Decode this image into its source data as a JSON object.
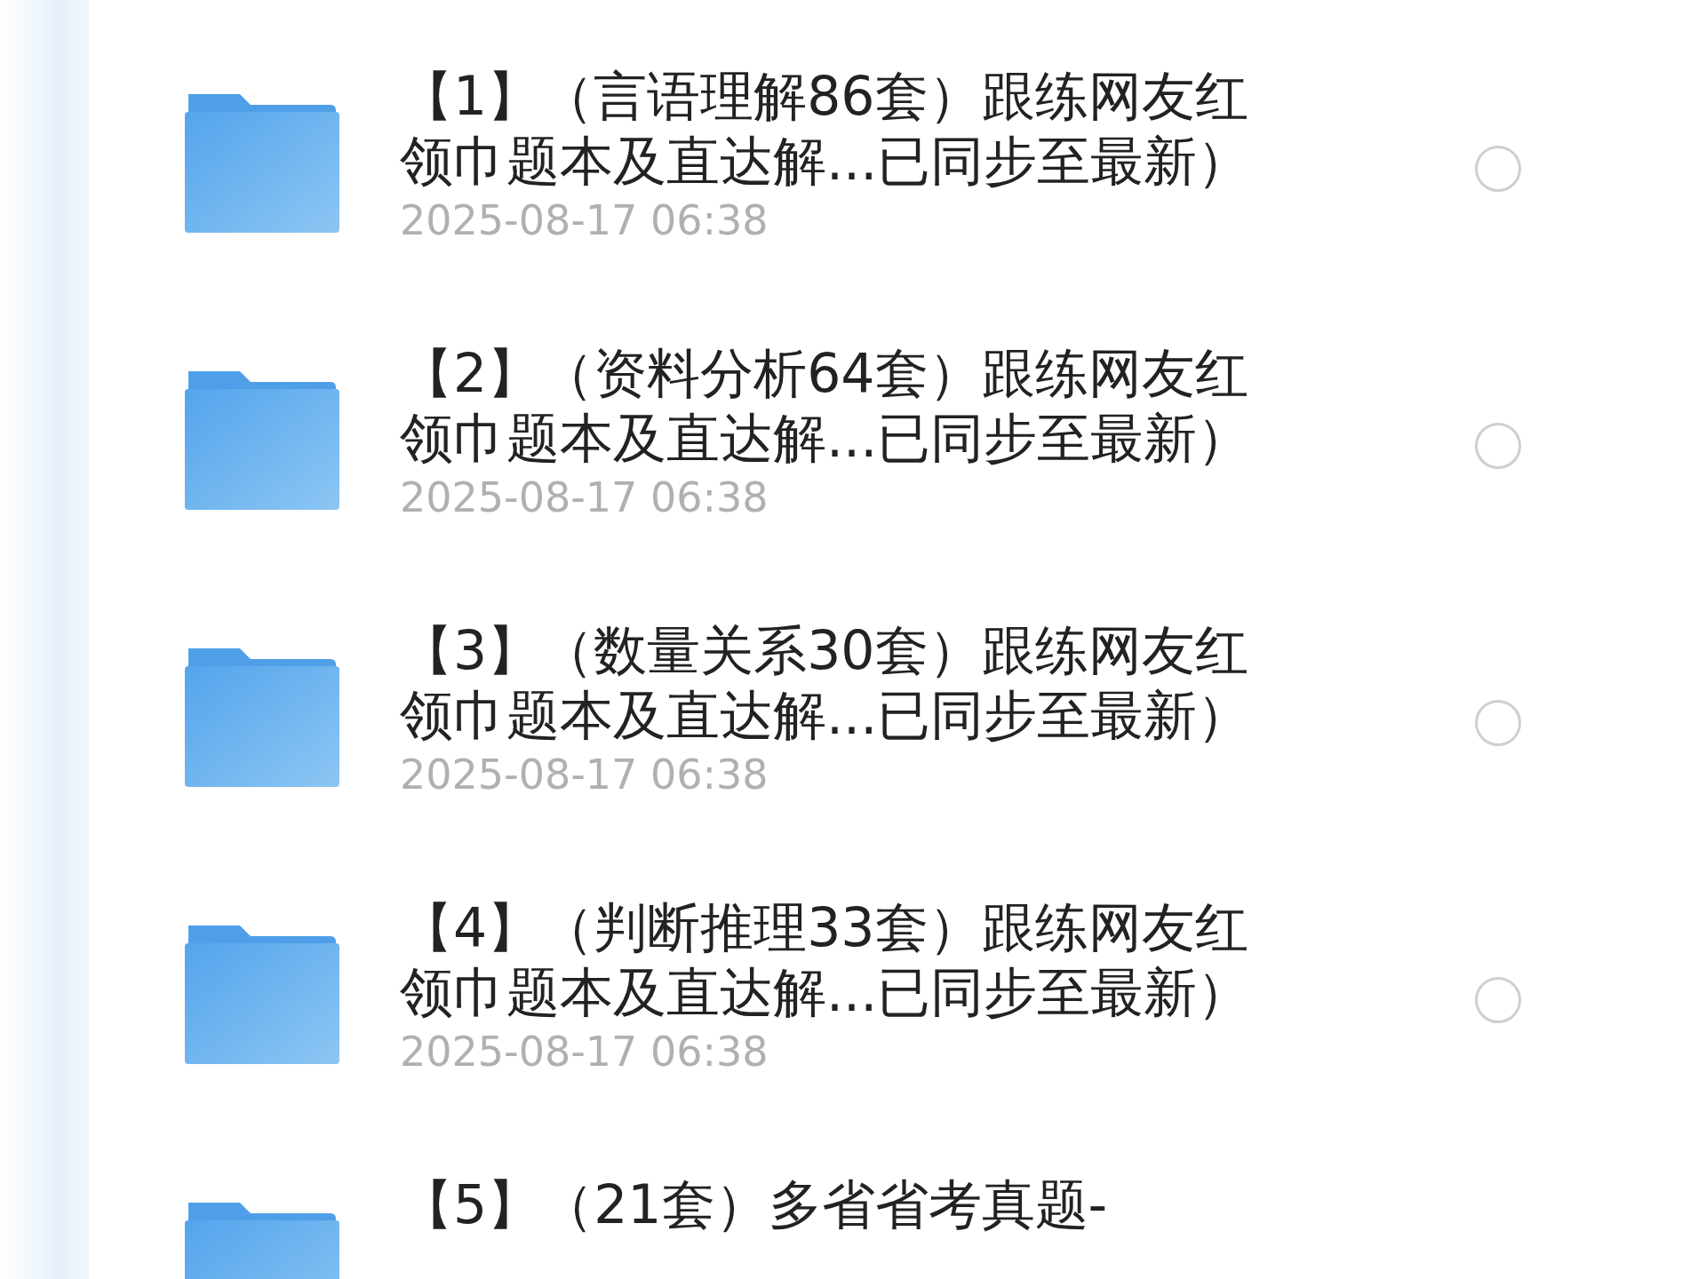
{
  "files": [
    {
      "title_lines": [
        "【1】（言语理解86套）跟练网友红",
        "领巾题本及直达解...已同步至最新）"
      ],
      "date": "2025-08-17 06:38",
      "selected": false
    },
    {
      "title_lines": [
        "【2】（资料分析64套）跟练网友红",
        "领巾题本及直达解...已同步至最新）"
      ],
      "date": "2025-08-17 06:38",
      "selected": false
    },
    {
      "title_lines": [
        "【3】（数量关系30套）跟练网友红",
        "领巾题本及直达解...已同步至最新）"
      ],
      "date": "2025-08-17 06:38",
      "selected": false
    },
    {
      "title_lines": [
        "【4】（判断推理33套）跟练网友红",
        "领巾题本及直达解...已同步至最新）"
      ],
      "date": "2025-08-17 06:38",
      "selected": false
    },
    {
      "title_lines": [
        "【5】（21套）多省省考真题-"
      ]
    }
  ]
}
